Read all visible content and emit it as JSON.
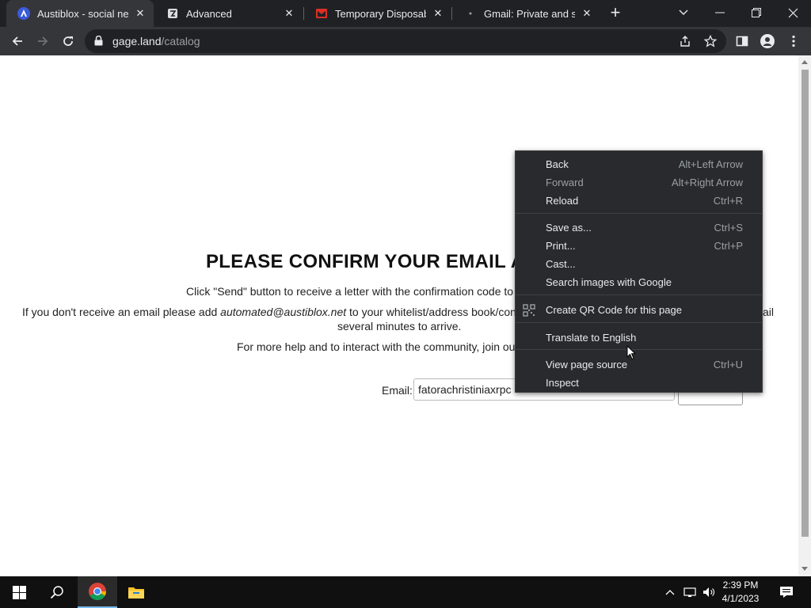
{
  "browser": {
    "tabs": [
      {
        "title": "Austiblox - social netw",
        "favicon": "austiblox-logo-icon",
        "active": true
      },
      {
        "title": "Advanced",
        "favicon": "advanced-logo-icon",
        "active": false
      },
      {
        "title": "Temporary Disposable",
        "favicon": "mail-logo-icon",
        "active": false
      },
      {
        "title": "Gmail: Private and secu",
        "favicon": "gmail-logo-icon",
        "active": false
      }
    ],
    "new_tab": "+",
    "url_host": "gage.land",
    "url_path": "/catalog"
  },
  "page": {
    "heading": "PLEASE CONFIRM YOUR EMAIL AD",
    "line1": "Click \"Send\" button to receive a letter with the confirmation code to",
    "line2_prefix": "If you don't receive an email please add ",
    "line2_email": "automated@austiblox.net",
    "line2_suffix": " to your whitelist/address book/cont",
    "line2_tail": "ail",
    "line3": "several minutes to arrive.",
    "line4": "For more help and to interact with the community, join ou",
    "email_label": "Email:",
    "email_value": "fatorachristiniaxrpc",
    "send_label": ""
  },
  "context_menu": {
    "items": [
      {
        "label": "Back",
        "shortcut": "Alt+Left Arrow",
        "disabled": false
      },
      {
        "label": "Forward",
        "shortcut": "Alt+Right Arrow",
        "disabled": true
      },
      {
        "label": "Reload",
        "shortcut": "Ctrl+R",
        "disabled": false
      },
      {
        "label": "Save as...",
        "shortcut": "Ctrl+S",
        "disabled": false
      },
      {
        "label": "Print...",
        "shortcut": "Ctrl+P",
        "disabled": false
      },
      {
        "label": "Cast...",
        "shortcut": "",
        "disabled": false
      },
      {
        "label": "Search images with Google",
        "shortcut": "",
        "disabled": false
      },
      {
        "label": "Create QR Code for this page",
        "shortcut": "",
        "disabled": false,
        "icon": "qr-code-icon"
      },
      {
        "label": "Translate to English",
        "shortcut": "",
        "disabled": false
      },
      {
        "label": "View page source",
        "shortcut": "Ctrl+U",
        "disabled": false
      },
      {
        "label": "Inspect",
        "shortcut": "",
        "disabled": false
      }
    ]
  },
  "taskbar": {
    "time": "2:39 PM",
    "date": "4/1/2023"
  },
  "colors": {
    "tab_strip": "#202124",
    "toolbar": "#35363a",
    "menu_bg": "#292a2d",
    "taskbar": "#101010"
  }
}
